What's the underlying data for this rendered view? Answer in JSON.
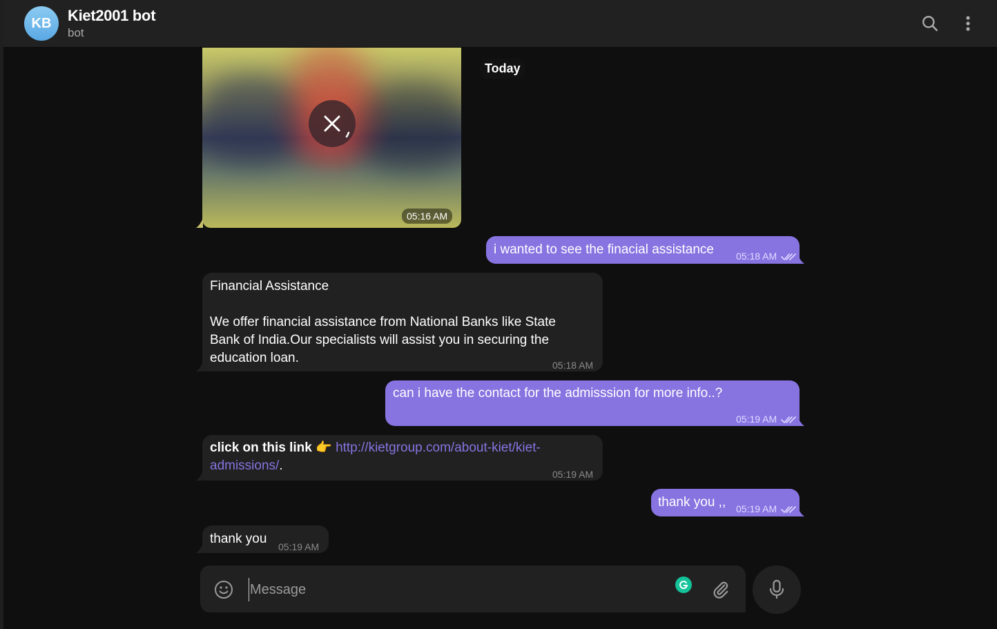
{
  "header": {
    "avatar_initials": "KB",
    "title": "Kiet2001 bot",
    "subtitle": "bot",
    "icons": [
      "search-icon",
      "more-vertical-icon"
    ]
  },
  "date_divider": "Today",
  "messages": [
    {
      "direction": "in",
      "type": "media",
      "time": "05:16 AM",
      "icon": "cancel-download-icon"
    },
    {
      "direction": "out",
      "text": "i wanted to see the finacial assistance",
      "time": "05:18 AM",
      "status": "read"
    },
    {
      "direction": "in",
      "title": "Financial Assistance",
      "text": "We offer financial assistance from National Banks like State Bank of India.Our specialists will assist you in securing the education loan.",
      "time": "05:18 AM"
    },
    {
      "direction": "out",
      "text": "can i have the contact for the admisssion for more info..?",
      "time": "05:19 AM",
      "status": "read"
    },
    {
      "direction": "in",
      "bold_text": "click on this link",
      "emoji": "👉",
      "link": "http://kietgroup.com/about-kiet/kiet-admissions/",
      "trailing": ".",
      "time": "05:19 AM"
    },
    {
      "direction": "out",
      "text": "thank you ,,",
      "time": "05:19 AM",
      "status": "read"
    },
    {
      "direction": "in",
      "text": "thank you",
      "time": "05:19 AM"
    }
  ],
  "composer": {
    "placeholder": "Message",
    "value": "",
    "icons": [
      "smile-icon",
      "grammarly-icon",
      "paperclip-icon",
      "microphone-icon"
    ]
  },
  "colors": {
    "accent": "#8774e1",
    "background": "#0f0f0f",
    "bubble_in": "#212121",
    "header": "#212121"
  }
}
